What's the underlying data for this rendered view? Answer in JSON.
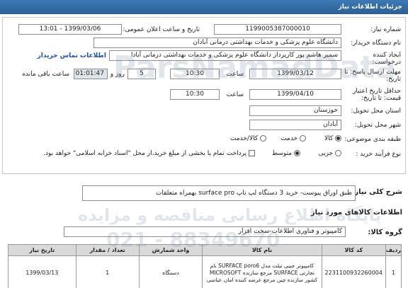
{
  "header": {
    "title": "جزئیات اطلاعات نیاز"
  },
  "fields": {
    "need_number_label": "شماره نیاز:",
    "need_number": "1199005387000010",
    "announce_label": "تاریخ و ساعت اعلان عمومی:",
    "announce_value": "1399/03/06 - 13:01",
    "buyer_label": "نام دستگاه خریدار:",
    "buyer_value": "دانشگاه علوم پزشکی و خدمات بهداشتی درمانی آبادان",
    "creator_label": "ایجاد کننده درخواست:",
    "creator_value": "سمیر هاشم پور کارپرداز دانشگاه علوم پزشکی و خدمات بهداشتی درمانی آبادا",
    "contact_link": "اطلاعات تماس خریدار",
    "reply_label": "مهلت ارسال پاسخ: تا تاریخ:",
    "reply_date": "1399/03/12",
    "time_label": "ساعت",
    "reply_time": "10:30",
    "days_value": "5",
    "days_label": "روز و",
    "remaining_time": "01:01:47",
    "remaining_label": "ساعت باقی مانده",
    "validity_label": "حداقل تاریخ اعتبار قیمت: تا تاریخ:",
    "validity_date": "1399/04/10",
    "validity_time": "10:30",
    "province_label": "استان محل تحویل:",
    "province_value": "خوزستان",
    "city_label": "شهر محل تحویل:",
    "city_value": "آبادان",
    "category_label": "طبقه بندی موضوعی:",
    "category_options": [
      "کالا",
      "خدمت",
      "کالا/خدمت"
    ],
    "category_selected": 0,
    "process_label": "نوع فرآیند خرید :",
    "process_options": [
      "جزیی",
      "متوسط"
    ],
    "process_selected": 1,
    "payment_note": "پرداخت تمام یا بخشی از مبلغ خرید،از محل \"اسناد خزانه اسلامی\" خواهد بود."
  },
  "summary": {
    "label": "شرح کلی نیاز:",
    "value": "طبق اوراق پیوست- خرید 3 دستگاه لپ تاپ surface pro بهمراه متعلقات"
  },
  "goods": {
    "section_title": "اطلاعات کالاهای مورد نیاز",
    "group_label": "گروه کالا:",
    "group_value": "کامپیوتر و فناوری اطلاعات-سخت افزار",
    "columns": [
      "ردیف",
      "کد کالا",
      "نام کالا",
      "واحد شمارش",
      "تعداد / مقدار",
      "تاریخ نیاز"
    ],
    "rows": [
      {
        "index": "1",
        "code": "2231100932260004",
        "name": "کامپیوتر جیبی تبلت مدل SURFACE poro6 نام تجارتی SURFACE مرجع سازنده MICROSOFT کشور سازنده چین مرجع عرضه کننده امان عباسی",
        "unit": "دستگاه",
        "qty": "1",
        "date": "1399/03/13"
      }
    ]
  },
  "watermark": {
    "line1": "ParsNamadData",
    "line2": "پایگاه اطلاع رسانی مناقصه و مزایده",
    "phone": "021 - 88349670"
  }
}
